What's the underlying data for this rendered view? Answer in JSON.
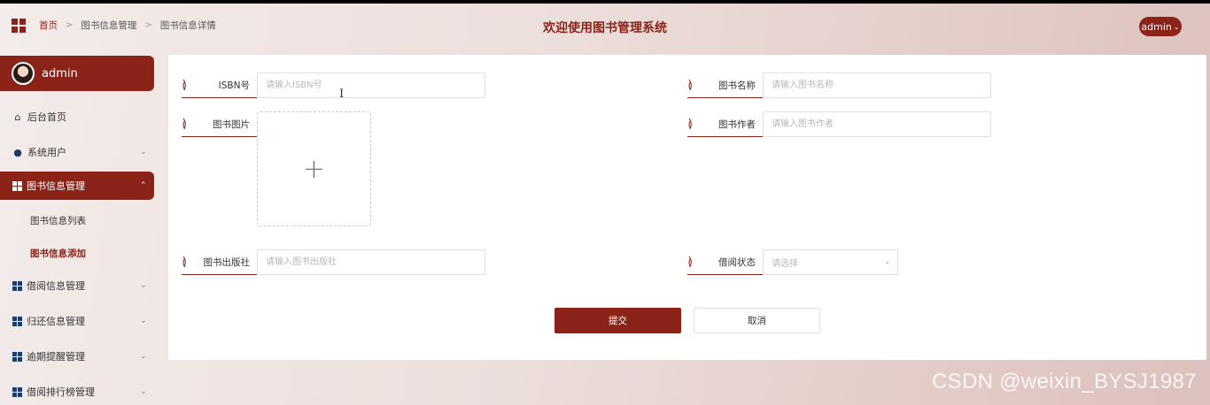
{
  "header": {
    "menu_icon": "grid-icon",
    "breadcrumb": [
      "首页",
      "图书信息管理",
      "图书信息详情"
    ],
    "breadcrumb_separator": ">",
    "title": "欢迎使用图书管理系统",
    "user_menu_label": "admin",
    "user_menu_caret": "⌄"
  },
  "sidebar": {
    "profile_name": "admin",
    "items": [
      {
        "label": "后台首页",
        "icon": "home-icon"
      },
      {
        "label": "系统用户",
        "icon": "user-icon",
        "chevron": "⌄"
      },
      {
        "label": "图书信息管理",
        "icon": "grid-icon",
        "chevron": "⌃",
        "active": true
      },
      {
        "label": "借阅信息管理",
        "icon": "grid-icon",
        "chevron": "⌄"
      },
      {
        "label": "归还信息管理",
        "icon": "grid-icon",
        "chevron": "⌄"
      },
      {
        "label": "逾期提醒管理",
        "icon": "grid-icon",
        "chevron": "⌄"
      },
      {
        "label": "借阅排行榜管理",
        "icon": "grid-icon",
        "chevron": "⌄"
      }
    ],
    "sub_items": [
      {
        "label": "图书信息列表",
        "current": false
      },
      {
        "label": "图书信息添加",
        "current": true
      }
    ]
  },
  "form": {
    "isbn": {
      "label": "ISBN号",
      "placeholder": "请输入ISBN号",
      "value": ""
    },
    "book_name": {
      "label": "图书名称",
      "placeholder": "请输入图书名称",
      "value": ""
    },
    "book_image": {
      "label": "图书图片",
      "upload_symbol": "+"
    },
    "book_author": {
      "label": "图书作者",
      "placeholder": "请输入图书作者",
      "value": ""
    },
    "publisher": {
      "label": "图书出版社",
      "placeholder": "请输入图书出版社",
      "value": ""
    },
    "borrow_status": {
      "label": "借阅状态",
      "placeholder": "请选择",
      "caret": "⌄"
    },
    "submit_label": "提交",
    "cancel_label": "取消"
  },
  "watermark": "CSDN @weixin_BYSJ1987",
  "colors": {
    "accent": "#8b2319",
    "icon_blue": "#1f3e67"
  }
}
